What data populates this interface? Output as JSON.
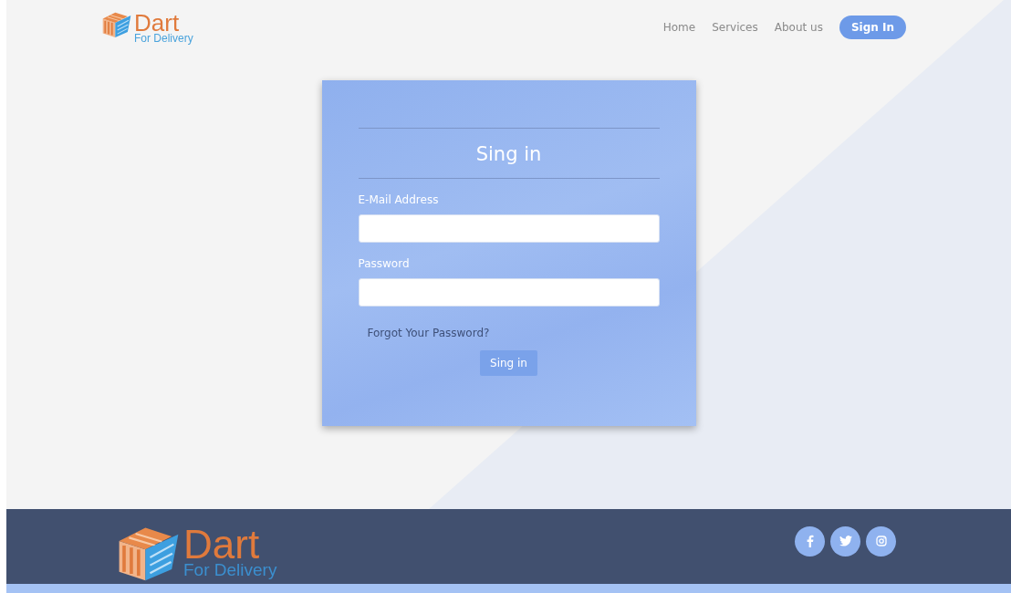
{
  "header": {
    "logo": {
      "title": "Dart",
      "subtitle": "For Delivery"
    },
    "nav": [
      {
        "label": "Home",
        "kind": "link"
      },
      {
        "label": "Services",
        "kind": "link"
      },
      {
        "label": "About us",
        "kind": "link"
      },
      {
        "label": "Sign In",
        "kind": "button"
      }
    ]
  },
  "login_card": {
    "title": "Sing in",
    "fields": [
      {
        "label": "E-Mail Address"
      },
      {
        "label": "Password"
      }
    ],
    "forgot_link": "Forgot Your Password?",
    "submit_button": "Sing in"
  },
  "footer": {
    "logo": {
      "title": "Dart",
      "subtitle": "For Delivery"
    },
    "social": [
      {
        "kind": "facebook"
      },
      {
        "kind": "twitter"
      },
      {
        "kind": "instagram"
      }
    ]
  }
}
